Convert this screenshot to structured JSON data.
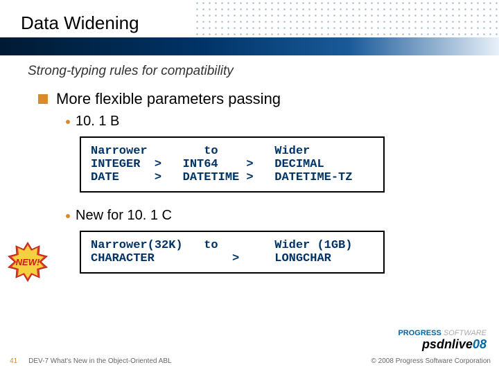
{
  "header": {
    "title": "Data Widening",
    "subtitle": "Strong-typing rules for compatibility"
  },
  "bullets": {
    "main": "More flexible parameters passing",
    "sub1": "10. 1 B",
    "code1": "Narrower        to        Wider\nINTEGER  >   INT64    >   DECIMAL\nDATE     >   DATETIME >   DATETIME-TZ",
    "sub2": "New for 10. 1 C",
    "code2": "Narrower(32K)   to        Wider (1GB)\nCHARACTER           >     LONGCHAR"
  },
  "badge": {
    "label": "NEW!"
  },
  "logo": {
    "brand": "PROGRESS",
    "sub": "SOFTWARE",
    "event": "psdnlive",
    "year": "08"
  },
  "footer": {
    "page": "41",
    "session": "DEV-7 What's New in the Object-Oriented ABL",
    "copyright": "© 2008 Progress Software Corporation"
  }
}
